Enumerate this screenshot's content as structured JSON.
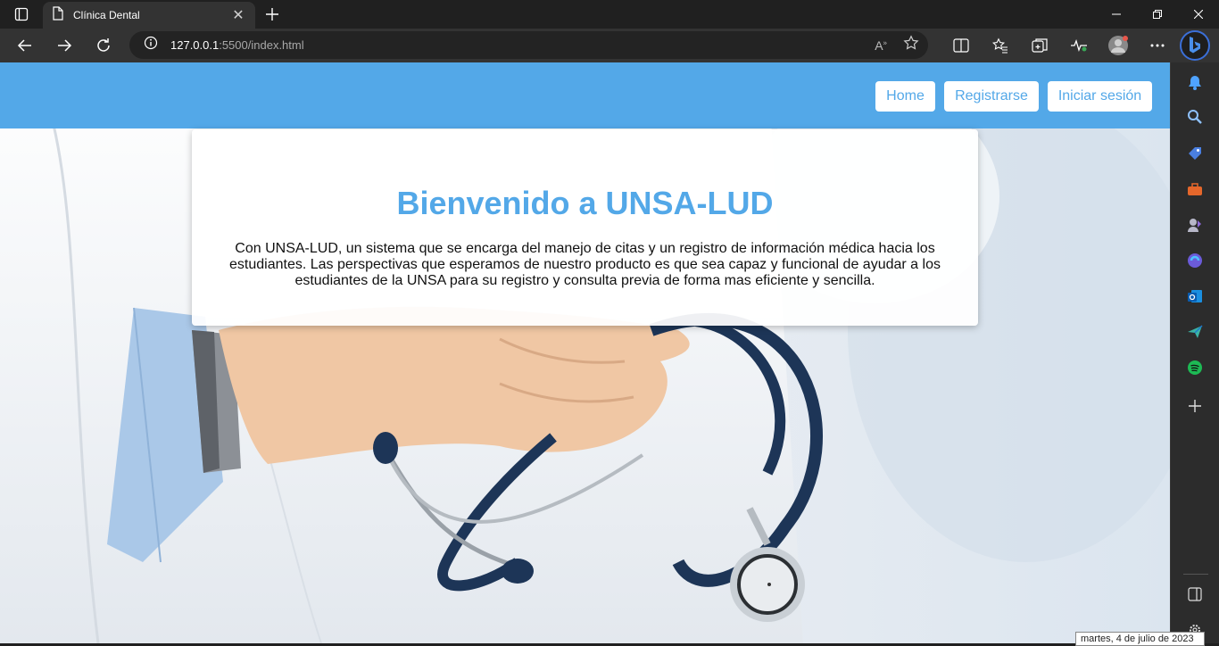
{
  "browser": {
    "tab_title": "Clínica Dental",
    "url_host": "127.0.0.1",
    "url_rest": ":5500/index.html"
  },
  "site": {
    "nav": [
      {
        "label": "Home"
      },
      {
        "label": "Registrarse"
      },
      {
        "label": "Iniciar sesión"
      }
    ],
    "hero": {
      "title": "Bienvenido a UNSA-LUD",
      "text": "Con UNSA-LUD, un sistema que se encarga del manejo de citas y un registro de información médica hacia los estudiantes. Las perspectivas que esperamos de nuestro producto es que sea capaz y funcional de ayudar a los estudiantes de la UNSA para su registro y consulta previa de forma mas eficiente y sencilla."
    },
    "colors": {
      "header": "#53a8e8",
      "accent": "#53a8e8"
    }
  },
  "system": {
    "date_tooltip": "martes, 4 de julio de 2023"
  },
  "icons": {
    "sidebar": [
      "bell-icon",
      "search-icon",
      "tag-icon",
      "toolbox-icon",
      "games-icon",
      "copilot-icon",
      "outlook-icon",
      "send-icon",
      "spotify-icon",
      "add-icon",
      "split-panel-icon",
      "settings-icon"
    ]
  }
}
